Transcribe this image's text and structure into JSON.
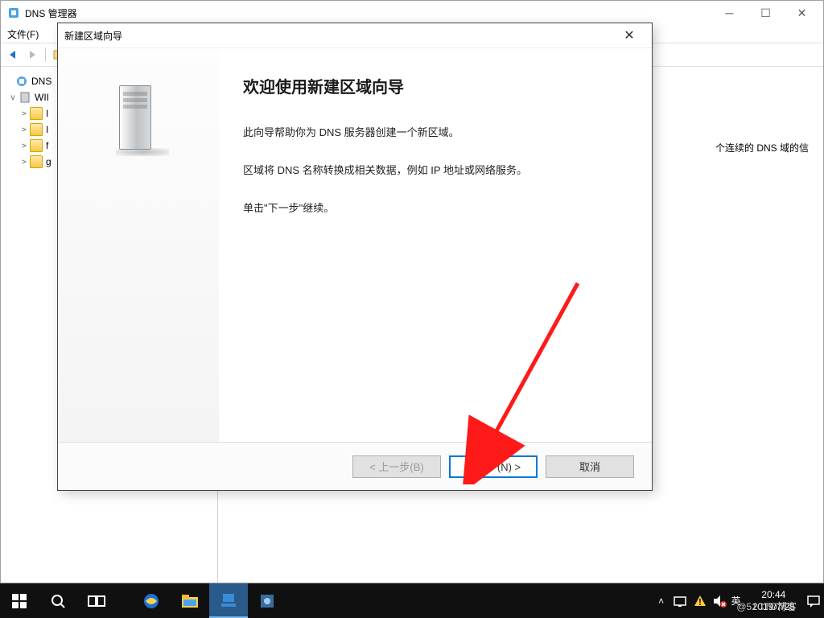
{
  "main_window": {
    "title": "DNS 管理器",
    "menu": {
      "file_label": "文件(F)"
    },
    "tree": {
      "root_label": "DNS",
      "server_label": "WII",
      "folders": [
        "I",
        "I",
        "f",
        "g"
      ]
    },
    "content": {
      "hint_text": "个连续的 DNS 域的信"
    }
  },
  "dialog": {
    "title": "新建区域向导",
    "heading": "欢迎使用新建区域向导",
    "para1": "此向导帮助你为 DNS 服务器创建一个新区域。",
    "para2": "区域将 DNS 名称转换成相关数据，例如 IP 地址或网络服务。",
    "para3": "单击\"下一步\"继续。",
    "back_label": "< 上一步(B)",
    "next_label": "下一步(N) >",
    "cancel_label": "取消"
  },
  "taskbar": {
    "ime_label": "英",
    "clock_time": "20:44",
    "clock_date": "2019/7/25",
    "watermark": "@51CTO博客"
  }
}
